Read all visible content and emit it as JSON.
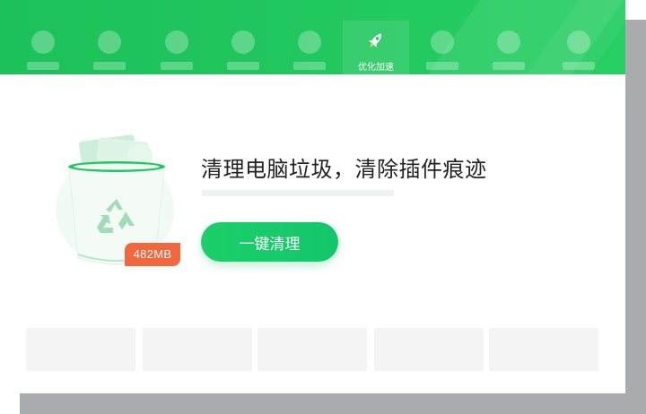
{
  "nav": {
    "tabs": [
      {
        "label": "",
        "active": false
      },
      {
        "label": "",
        "active": false
      },
      {
        "label": "",
        "active": false
      },
      {
        "label": "",
        "active": false
      },
      {
        "label": "",
        "active": false
      },
      {
        "label": "优化加速",
        "active": true
      },
      {
        "label": "",
        "active": false
      },
      {
        "label": "",
        "active": false
      },
      {
        "label": "",
        "active": false
      }
    ],
    "active_icon": "rocket-icon"
  },
  "clean": {
    "headline": "清理电脑垃圾，清除插件痕迹",
    "junk_size": "482MB",
    "progress": 0,
    "button_label": "一键清理",
    "illustration_icon": "recycle-icon"
  },
  "colors": {
    "brand_green": "#22c95f",
    "badge_orange": "#f2673d"
  },
  "cards": [
    "",
    "",
    "",
    "",
    ""
  ]
}
